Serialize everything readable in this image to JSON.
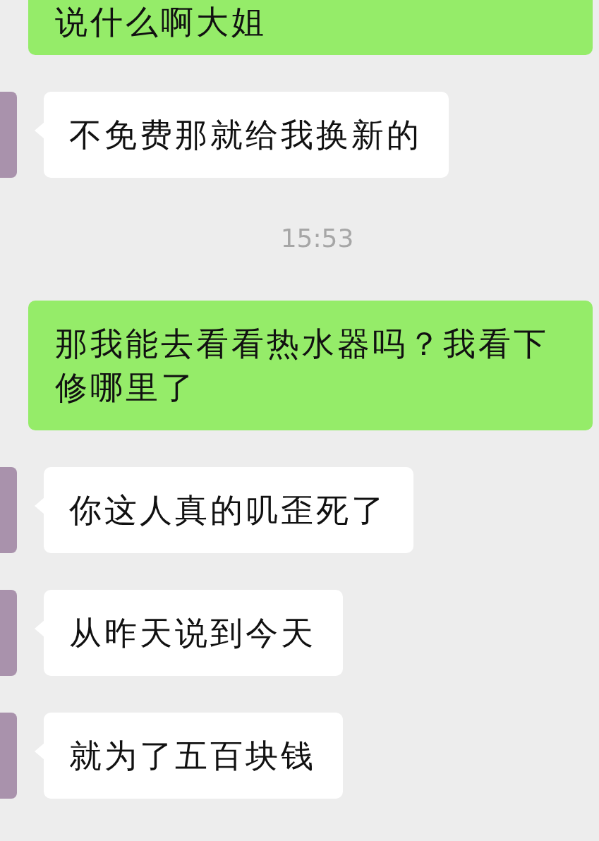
{
  "messages": [
    {
      "kind": "sent",
      "text": "说什么啊大姐"
    },
    {
      "kind": "received",
      "text": "不免费那就给我换新的"
    },
    {
      "kind": "time",
      "text": "15:53"
    },
    {
      "kind": "sent",
      "text": "那我能去看看热水器吗？我看下修哪里了"
    },
    {
      "kind": "received",
      "text": "你这人真的叽歪死了"
    },
    {
      "kind": "received",
      "text": "从昨天说到今天"
    },
    {
      "kind": "received",
      "text": "就为了五百块钱"
    }
  ]
}
